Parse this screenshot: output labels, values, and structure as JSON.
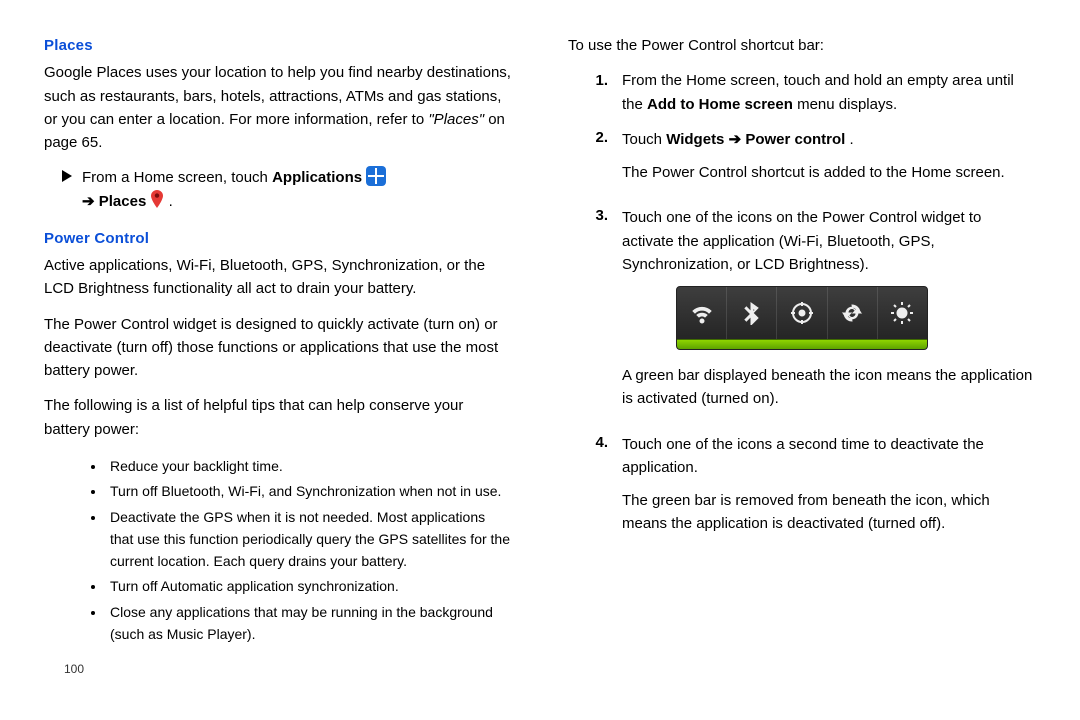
{
  "left": {
    "places_heading": "Places",
    "places_para_pre": "Google Places uses your location to help you find nearby destinations, such as restaurants, bars, hotels, attractions, ATMs and gas stations, or you can enter a location. For more information, refer to ",
    "places_para_em": "\"Places\"",
    "places_para_post": " on page 65.",
    "step_pre": "From a Home screen, touch ",
    "step_bold1": "Applications",
    "arrow1": "➔",
    "step_bold2": "Places",
    "period": ".",
    "power_heading": "Power Control",
    "power_p1": "Active applications, Wi-Fi, Bluetooth, GPS, Synchronization, or the LCD Brightness functionality all act to drain your battery.",
    "power_p2": "The Power Control widget is designed to quickly activate (turn on) or deactivate (turn off) those functions or applications that use the most battery power.",
    "power_p3": "The following is a list of helpful tips that can help conserve your battery power:",
    "tips": [
      "Reduce your backlight time.",
      "Turn off Bluetooth, Wi-Fi, and Synchronization when not in use.",
      "Deactivate the GPS when it is not needed. Most applications that use this function periodically query the GPS satellites for the current location. Each query drains your battery.",
      "Turn off Automatic application synchronization.",
      "Close any applications that may be running in the background (such as Music Player)."
    ],
    "page_number": "100"
  },
  "right": {
    "intro": "To use the Power Control shortcut bar:",
    "s1_num": "1.",
    "s1_a": "From the Home screen, touch and hold an empty area until the ",
    "s1_b_bold": "Add to Home screen",
    "s1_c": " menu displays.",
    "s2_num": "2.",
    "s2_a": "Touch ",
    "s2_b_bold": "Widgets",
    "s2_arrow": " ➔ ",
    "s2_c_bold": "Power control",
    "s2_d": ".",
    "s2_after": "The Power Control shortcut is added to the Home screen.",
    "s3_num": "3.",
    "s3_a": "Touch one of the icons on the Power Control widget to activate the application (Wi-Fi, Bluetooth, GPS, Synchronization, or LCD Brightness).",
    "s3_after": "A green bar displayed beneath the icon means the application is activated (turned on).",
    "s4_num": "4.",
    "s4_a": "Touch one of the icons a second time to deactivate the application.",
    "s4_after": "The green bar is removed from beneath the icon, which means the application is deactivated (turned off)."
  }
}
